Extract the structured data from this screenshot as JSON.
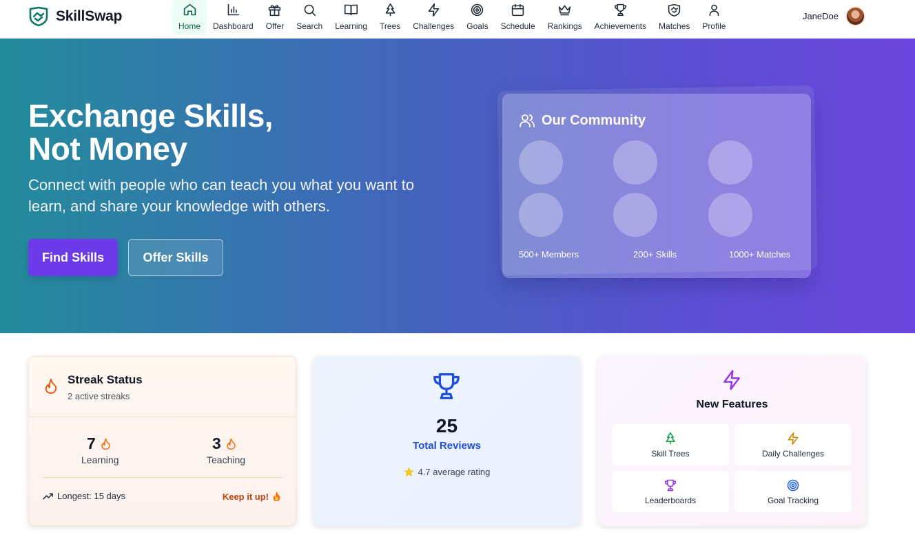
{
  "app": {
    "name": "SkillSwap",
    "accent": "#0f766e"
  },
  "nav": {
    "items": [
      {
        "label": "Home",
        "icon": "home-icon",
        "active": true
      },
      {
        "label": "Dashboard",
        "icon": "bar-chart-icon"
      },
      {
        "label": "Offer",
        "icon": "gift-icon"
      },
      {
        "label": "Search",
        "icon": "search-icon"
      },
      {
        "label": "Learning",
        "icon": "book-icon"
      },
      {
        "label": "Trees",
        "icon": "tree-icon"
      },
      {
        "label": "Challenges",
        "icon": "bolt-icon"
      },
      {
        "label": "Goals",
        "icon": "target-icon"
      },
      {
        "label": "Schedule",
        "icon": "calendar-icon"
      },
      {
        "label": "Rankings",
        "icon": "crown-icon"
      },
      {
        "label": "Achievements",
        "icon": "trophy-icon"
      },
      {
        "label": "Matches",
        "icon": "handshake-icon"
      },
      {
        "label": "Profile",
        "icon": "user-icon"
      }
    ]
  },
  "user": {
    "name": "JaneDoe"
  },
  "hero": {
    "title_line1": "Exchange Skills,",
    "title_line2": "Not Money",
    "subtitle": "Connect with people who can teach you what you want to learn, and share your knowledge with others.",
    "find_label": "Find Skills",
    "offer_label": "Offer Skills"
  },
  "community": {
    "title": "Our Community",
    "stats": [
      "500+ Members",
      "200+ Skills",
      "1000+ Matches"
    ]
  },
  "streak": {
    "title": "Streak Status",
    "subtitle": "2 active streaks",
    "learning_value": "7",
    "learning_label": "Learning",
    "teaching_value": "3",
    "teaching_label": "Teaching",
    "longest": "Longest: 15 days",
    "keep_up": "Keep it up!"
  },
  "reviews": {
    "count": "25",
    "label": "Total Reviews",
    "rating": "4.7 average rating"
  },
  "features": {
    "title": "New Features",
    "items": [
      {
        "label": "Skill Trees",
        "icon": "tree-icon",
        "color": "#16a34a"
      },
      {
        "label": "Daily Challenges",
        "icon": "bolt-icon",
        "color": "#ca8a04"
      },
      {
        "label": "Leaderboards",
        "icon": "trophy-icon",
        "color": "#9333ea"
      },
      {
        "label": "Goal Tracking",
        "icon": "target-icon",
        "color": "#2563eb"
      }
    ]
  }
}
